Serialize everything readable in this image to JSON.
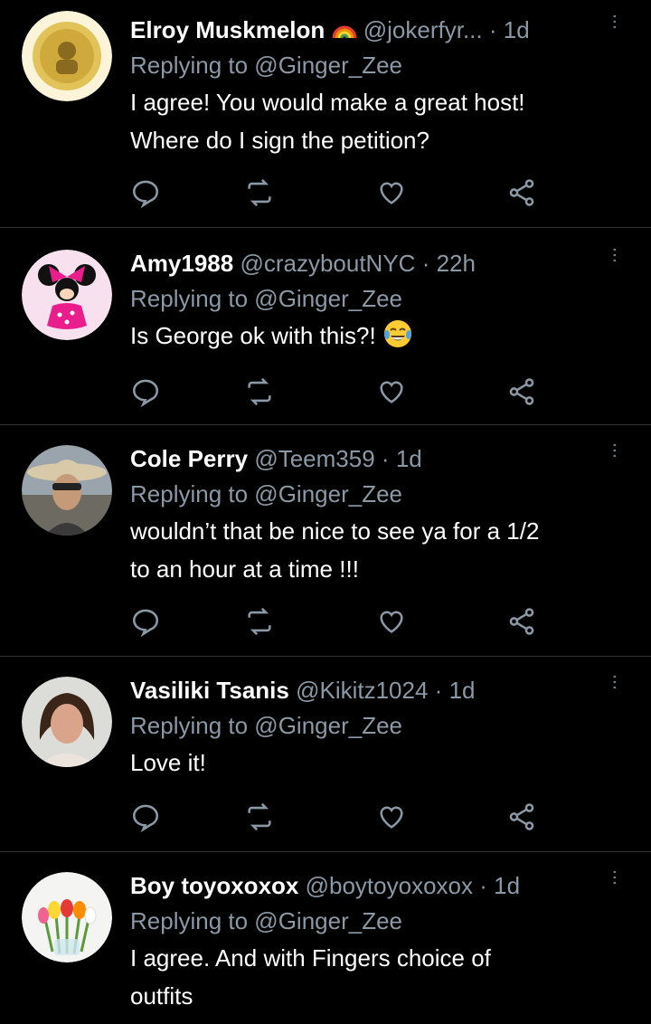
{
  "tweets": [
    {
      "name": "Elroy Muskmelon",
      "badge": "rainbow",
      "handle": "@jokerfyr...",
      "time": "1d",
      "replying": "Replying to @Ginger_Zee",
      "text": [
        "I agree! You would make a great host!",
        "Where do I sign the petition?"
      ],
      "avatar": "gold-coin-avatar"
    },
    {
      "name": "Amy1988",
      "handle": "@crazyboutNYC",
      "time": "22h",
      "replying": "Replying to @Ginger_Zee",
      "text": [
        "Is George ok with this?! "
      ],
      "emoji": "laughing-crying-face",
      "avatar": "minnie-mouse-avatar"
    },
    {
      "name": "Cole Perry",
      "handle": "@Teem359",
      "time": "1d",
      "replying": "Replying to @Ginger_Zee",
      "text": [
        "wouldn’t that be nice to see ya for a 1/2",
        "to an hour at a time !!!"
      ],
      "avatar": "cowboy-hat-avatar"
    },
    {
      "name": "Vasiliki Tsanis",
      "handle": "@Kikitz1024",
      "time": "1d",
      "replying": "Replying to @Ginger_Zee",
      "text": [
        "Love it!"
      ],
      "avatar": "woman-portrait-avatar"
    },
    {
      "name": "Boy toyoxoxox",
      "handle": "@boytoyoxoxox",
      "time": "1d",
      "replying": "Replying to @Ginger_Zee",
      "text": [
        "I agree. And with Fingers choice of",
        "outfits"
      ],
      "avatar": "tulips-avatar"
    }
  ],
  "dot": "·",
  "icons": [
    "reply-icon",
    "retweet-icon",
    "like-icon",
    "share-icon",
    "more-icon"
  ],
  "colors": {
    "background": "#000000",
    "muted": "#8b98a5",
    "divider": "#2f3336"
  }
}
